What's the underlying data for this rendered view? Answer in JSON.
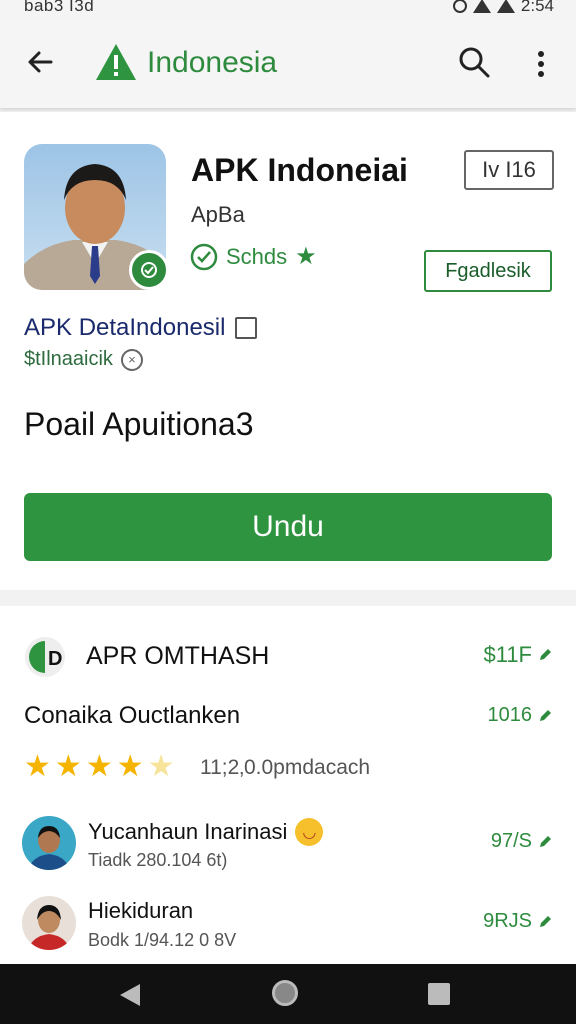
{
  "status_bar": {
    "left_text": "bab3 I3d",
    "time": "2:54"
  },
  "app_bar": {
    "title": "Indonesia"
  },
  "app": {
    "name": "APK Indoneiai",
    "developer": "ApBa",
    "version_badge": "Iv  I16",
    "rating_label": "Schds",
    "category_button": "Fgadlesik",
    "detail_title": "APK DetaIndonesil",
    "detail_subtitle": "$tIlnaaicik",
    "headline": "Poail Apuitiona3",
    "download_button": "Undu"
  },
  "section": {
    "title": "APR OMTHASH",
    "value": "$11F",
    "sub_label": "Conaika Ouctlanken",
    "sub_value": "1016",
    "rating_text": "11;2‚0.0pmdacach",
    "rating_stars": 4.5
  },
  "reviews": [
    {
      "name": "Yucanhaun Inarinasi",
      "meta": "Tiadk 280.104 6t)",
      "value": "97/S"
    },
    {
      "name": "Hiekiduran",
      "meta": "Bodk 1/94.12 0 8V",
      "value": "9RJS"
    }
  ],
  "colors": {
    "accent_green": "#2e9440",
    "text_green": "#2e8b3e"
  }
}
